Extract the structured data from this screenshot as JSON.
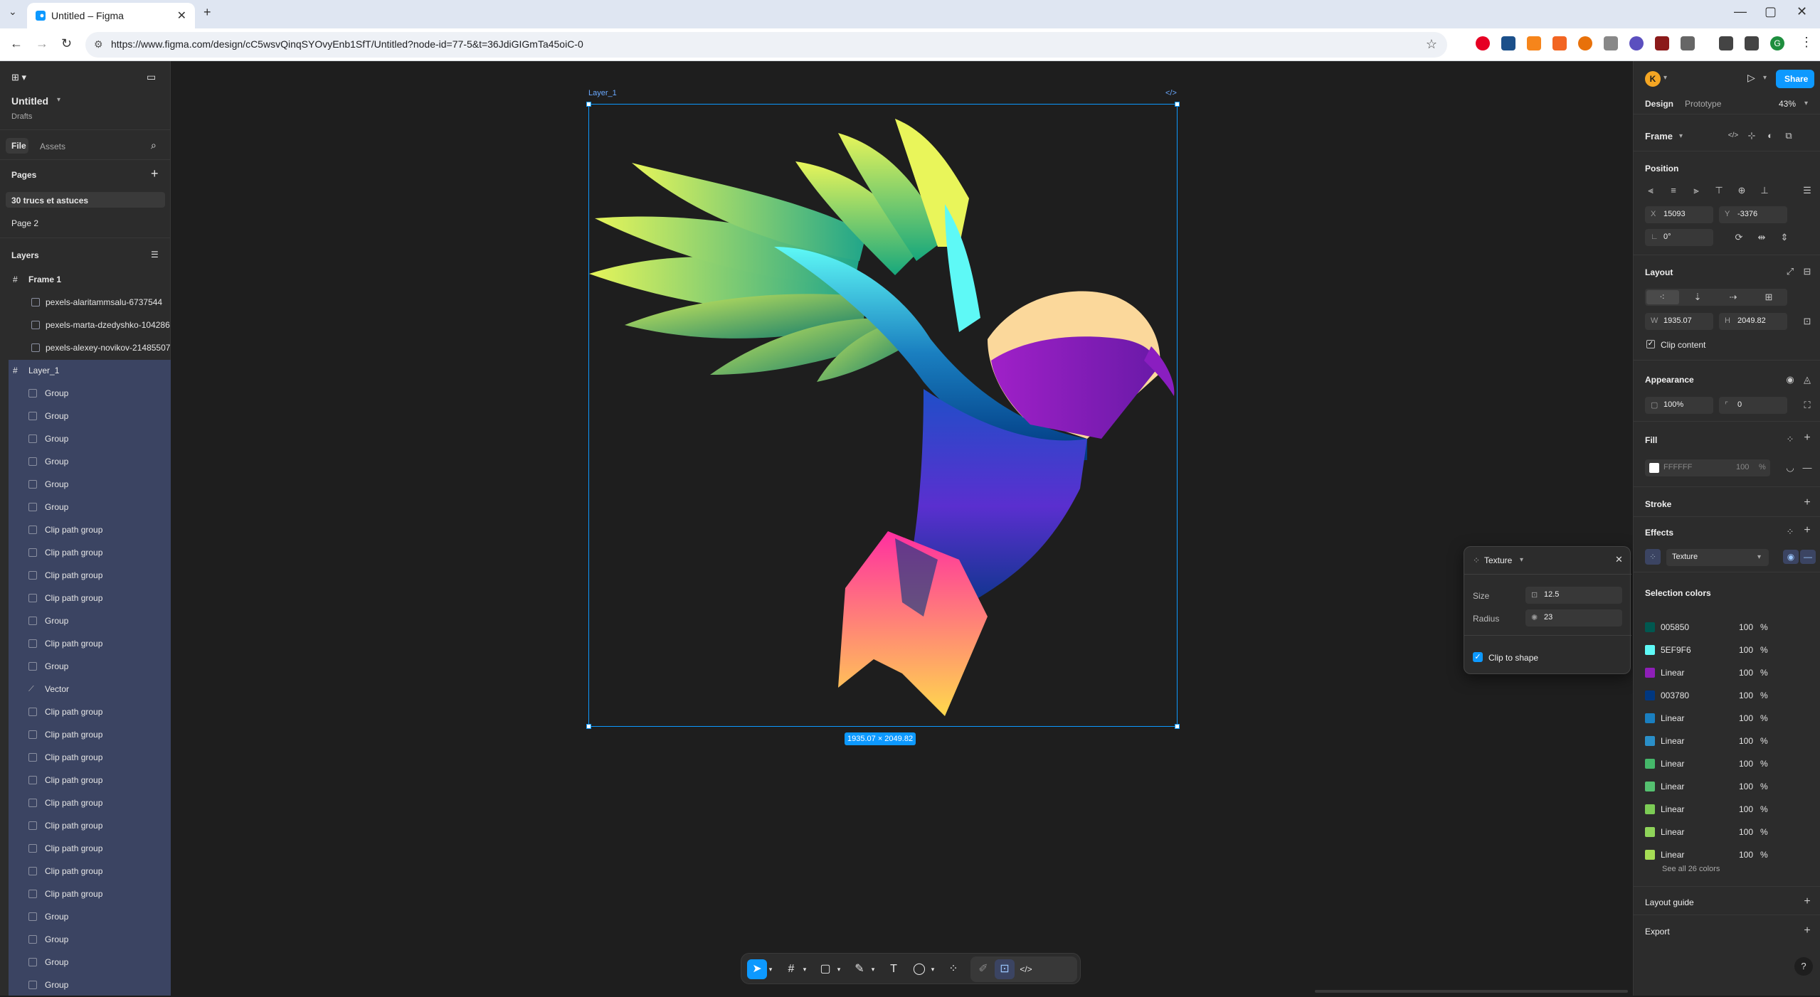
{
  "browser": {
    "tab_title": "Untitled – Figma",
    "url": "https://www.figma.com/design/cC5wsvQinqSYOvyEnb1SfT/Untitled?node-id=77-5&t=36JdiGIGmTa45oiC-0",
    "profile_initial": "G"
  },
  "file": {
    "name": "Untitled",
    "location": "Drafts"
  },
  "left_tabs": {
    "file": "File",
    "assets": "Assets"
  },
  "pages": {
    "heading": "Pages",
    "items": [
      "30 trucs et astuces",
      "Page 2"
    ]
  },
  "layers": {
    "heading": "Layers",
    "frame": "Frame 1",
    "images": [
      "pexels-alaritammsalu-6737544",
      "pexels-marta-dzedyshko-104286",
      "pexels-alexey-novikov-21485507"
    ],
    "selected": "Layer_1",
    "children": [
      "Group",
      "Group",
      "Group",
      "Group",
      "Group",
      "Group",
      "Clip path group",
      "Clip path group",
      "Clip path group",
      "Clip path group",
      "Group",
      "Clip path group",
      "Group",
      "Vector",
      "Clip path group",
      "Clip path group",
      "Clip path group",
      "Clip path group",
      "Clip path group",
      "Clip path group",
      "Clip path group",
      "Clip path group",
      "Clip path group",
      "Group",
      "Group",
      "Group",
      "Group"
    ]
  },
  "canvas": {
    "frame_label": "Layer_1",
    "dimensions": "1935.07 × 2049.82"
  },
  "texture_popup": {
    "title": "Texture",
    "size_label": "Size",
    "size_value": "12.5",
    "radius_label": "Radius",
    "radius_value": "23",
    "clip_label": "Clip to shape"
  },
  "right": {
    "avatar": "K",
    "tabs": {
      "design": "Design",
      "prototype": "Prototype"
    },
    "zoom": "43%",
    "share": "Share",
    "frame_type": "Frame",
    "position_heading": "Position",
    "x_label": "X",
    "x_value": "15093",
    "y_label": "Y",
    "y_value": "-3376",
    "rotation": "0°",
    "layout_heading": "Layout",
    "w_label": "W",
    "w_value": "1935.07",
    "h_label": "H",
    "h_value": "2049.82",
    "clip_content": "Clip content",
    "appearance_heading": "Appearance",
    "opacity": "100%",
    "radius": "0",
    "fill_heading": "Fill",
    "fill_hex": "FFFFFF",
    "fill_opacity": "100",
    "percent": "%",
    "stroke_heading": "Stroke",
    "effects_heading": "Effects",
    "effect_name": "Texture",
    "selection_colors_heading": "Selection colors",
    "see_all": "See all 26 colors",
    "layout_guide": "Layout guide",
    "export": "Export",
    "help": "?"
  },
  "selection_colors": [
    {
      "name": "005850",
      "opacity": "100",
      "color": "#005850"
    },
    {
      "name": "5EF9F6",
      "opacity": "100",
      "color": "#5EF9F6"
    },
    {
      "name": "Linear",
      "opacity": "100",
      "color": "#8e1fb7"
    },
    {
      "name": "003780",
      "opacity": "100",
      "color": "#003780"
    },
    {
      "name": "Linear",
      "opacity": "100",
      "color": "#1a7fc0"
    },
    {
      "name": "Linear",
      "opacity": "100",
      "color": "#2a8fc8"
    },
    {
      "name": "Linear",
      "opacity": "100",
      "color": "#45b86a"
    },
    {
      "name": "Linear",
      "opacity": "100",
      "color": "#55c070"
    },
    {
      "name": "Linear",
      "opacity": "100",
      "color": "#7ccc55"
    },
    {
      "name": "Linear",
      "opacity": "100",
      "color": "#8fd45a"
    },
    {
      "name": "Linear",
      "opacity": "100",
      "color": "#a6dd55"
    }
  ],
  "colors": {
    "accent": "#0d99ff",
    "canvas_bg": "#1e1e1e",
    "panel_bg": "#2c2c2c",
    "selected_layer_bg": "#3b4462"
  }
}
